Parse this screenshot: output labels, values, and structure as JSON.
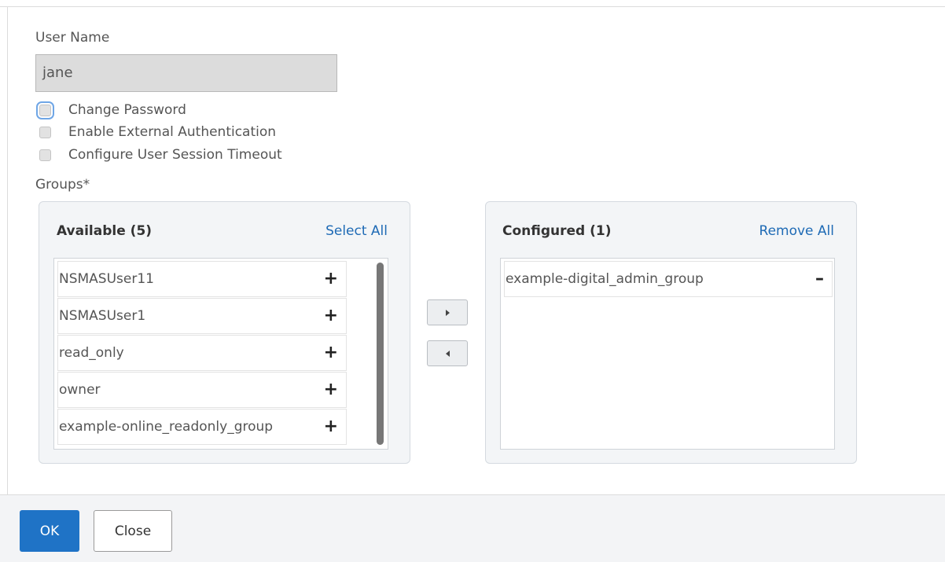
{
  "form": {
    "username_label": "User Name",
    "username_value": "jane",
    "checkboxes": [
      {
        "label": "Change Password",
        "checked": false
      },
      {
        "label": "Enable External Authentication",
        "checked": false
      },
      {
        "label": "Configure User Session Timeout",
        "checked": false
      }
    ],
    "groups_label": "Groups*"
  },
  "available": {
    "title": "Available (5)",
    "link": "Select All",
    "items": [
      "NSMASUser11",
      "NSMASUser1",
      "read_only",
      "owner",
      "example-online_readonly_group"
    ]
  },
  "configured": {
    "title": "Configured (1)",
    "link": "Remove All",
    "items": [
      "example-digital_admin_group"
    ]
  },
  "icons": {
    "add": "plus-icon",
    "remove": "minus-icon",
    "move_right": "arrow-right-icon",
    "move_left": "arrow-left-icon"
  },
  "footer": {
    "ok_label": "OK",
    "close_label": "Close"
  },
  "colors": {
    "primary": "#1f73c6",
    "link": "#1e6ab5",
    "focus": "#6fa6e6"
  }
}
